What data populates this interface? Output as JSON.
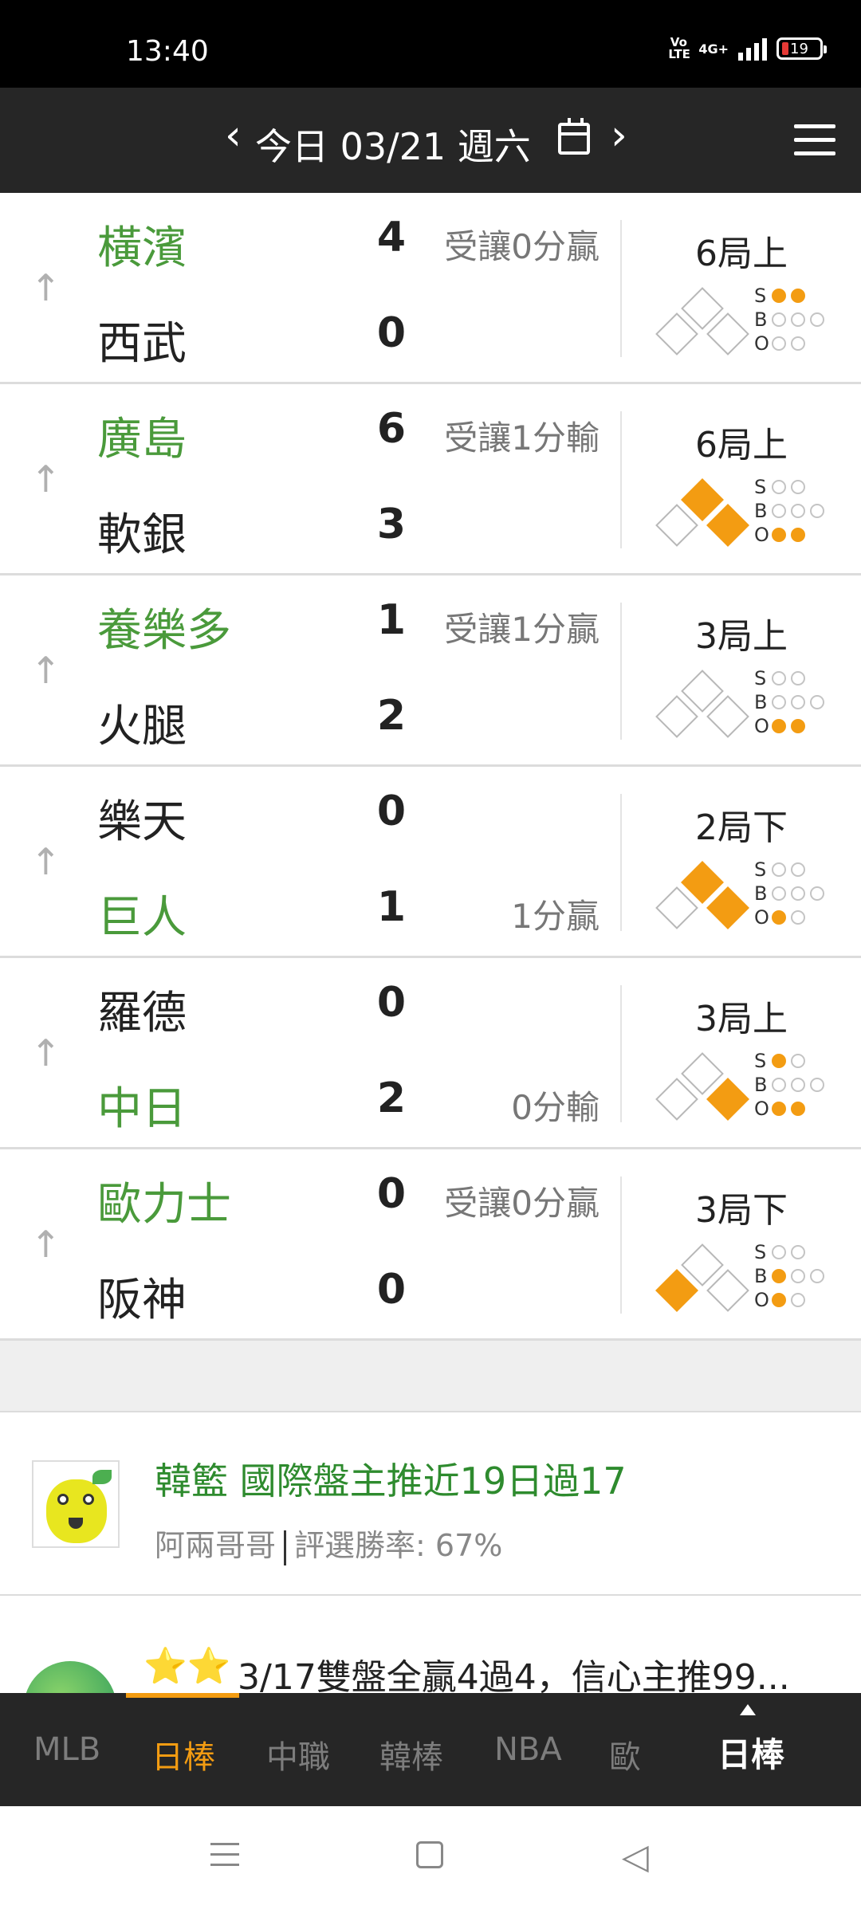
{
  "status_bar": {
    "time": "13:40",
    "volte": "Vo LTE",
    "network": "4G+",
    "battery": "19"
  },
  "header": {
    "prev": "‹",
    "date": "今日 03/21 週六",
    "next": "›"
  },
  "games": [
    {
      "away": "橫濱",
      "away_green": true,
      "away_score": "4",
      "home": "西武",
      "home_green": false,
      "home_score": "0",
      "odds_top": "受讓0分贏",
      "odds_bot": "",
      "inning": "6局上",
      "bases": [
        false,
        false,
        false
      ],
      "s": 2,
      "b": 0,
      "o": 0
    },
    {
      "away": "廣島",
      "away_green": true,
      "away_score": "6",
      "home": "軟銀",
      "home_green": false,
      "home_score": "3",
      "odds_top": "受讓1分輸",
      "odds_bot": "",
      "inning": "6局上",
      "bases": [
        true,
        true,
        false
      ],
      "s": 0,
      "b": 0,
      "o": 2
    },
    {
      "away": "養樂多",
      "away_green": true,
      "away_score": "1",
      "home": "火腿",
      "home_green": false,
      "home_score": "2",
      "odds_top": "受讓1分贏",
      "odds_bot": "",
      "inning": "3局上",
      "bases": [
        false,
        false,
        false
      ],
      "s": 0,
      "b": 0,
      "o": 2
    },
    {
      "away": "樂天",
      "away_green": false,
      "away_score": "0",
      "home": "巨人",
      "home_green": true,
      "home_score": "1",
      "odds_top": "",
      "odds_bot": "1分贏",
      "inning": "2局下",
      "bases": [
        true,
        true,
        false
      ],
      "s": 0,
      "b": 0,
      "o": 1
    },
    {
      "away": "羅德",
      "away_green": false,
      "away_score": "0",
      "home": "中日",
      "home_green": true,
      "home_score": "2",
      "odds_top": "",
      "odds_bot": "0分輸",
      "inning": "3局上",
      "bases": [
        true,
        false,
        false
      ],
      "s": 1,
      "b": 0,
      "o": 2
    },
    {
      "away": "歐力士",
      "away_green": true,
      "away_score": "0",
      "home": "阪神",
      "home_green": false,
      "home_score": "0",
      "odds_top": "受讓0分贏",
      "odds_bot": "",
      "inning": "3局下",
      "bases": [
        false,
        false,
        true
      ],
      "s": 0,
      "b": 1,
      "o": 1
    }
  ],
  "sbo_labels": [
    "S",
    "B",
    "O"
  ],
  "up_icon": "↑",
  "article1": {
    "title": "韓籃 國際盤主推近19日過17",
    "author": "阿兩哥哥",
    "rate": "評選勝率: 67%"
  },
  "article2": {
    "stars": "⭐⭐",
    "title": "3/17雙盤全贏4過4，信心主推99..."
  },
  "tabs": [
    {
      "label": "MLB",
      "active": false
    },
    {
      "label": "日棒",
      "active": true
    },
    {
      "label": "中職",
      "active": false
    },
    {
      "label": "韓棒",
      "active": false
    },
    {
      "label": "NBA",
      "active": false
    },
    {
      "label": "歐",
      "active": false
    }
  ],
  "current_tab": "日棒",
  "accent_color": "#f39c12",
  "team_green": "#4a9a3b"
}
